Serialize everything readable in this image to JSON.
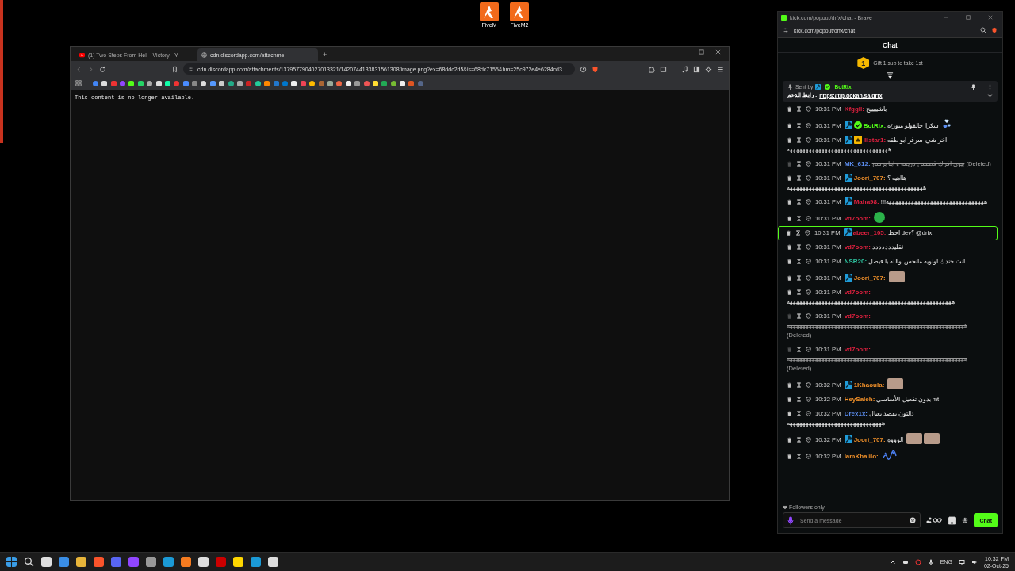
{
  "desktop": {
    "icons": [
      {
        "label": "FiveM"
      },
      {
        "label": "FiveM2"
      }
    ]
  },
  "browser": {
    "tabs": [
      {
        "title": "(1) Two Steps From Hell - Victory - Y",
        "selected": false,
        "kind": "video"
      },
      {
        "title": "cdn.discordapp.com/attachme",
        "selected": true,
        "kind": "web"
      }
    ],
    "new_tab": "+",
    "url": "cdn.discordapp.com/attachments/1379577904027013321/1420744133831561308/image.png?ex=68ddc2d5&is=68dc7155&hm=25c972e4e6284cd3...",
    "content": "This content is no longer available."
  },
  "chat_window": {
    "title": "kick.com/popout/drfx/chat - Brave",
    "url": "kick.com/popout/drfx/chat",
    "header": "Chat",
    "gift": {
      "rank": "1",
      "text": "Gift 1 sub to take 1st"
    },
    "pinned": {
      "sent_by": "Sent by",
      "author": "BotRix",
      "label": "رابط الدعم :",
      "link": "https://tip.dokan.sa/drfx"
    },
    "messages": [
      {
        "time": "10:31 PM",
        "username": "Kfggll:",
        "color": "#e0203f",
        "text": "باشيييييخ",
        "deleted": false,
        "highlighted": false
      },
      {
        "time": "10:31 PM",
        "username": "BotRix:",
        "color": "#53fc18",
        "badges": [
          {
            "kind": "moderator"
          },
          {
            "kind": "verified"
          }
        ],
        "text": "شكرا حالفولو متور/ه",
        "deleted": false,
        "highlighted": false,
        "emotes": [
          {
            "kind": "hearts"
          }
        ]
      },
      {
        "time": "10:31 PM",
        "username": "lllstar1:",
        "color": "#e0203f",
        "badges": [
          {
            "kind": "moderator"
          },
          {
            "kind": "crown"
          }
        ],
        "text": "اخر شي سرفر ابو طقه",
        "continued": "ههههههههههههههههههههههههههههههههه",
        "deleted": false,
        "highlighted": false
      },
      {
        "time": "10:31 PM",
        "username": "MK_612:",
        "color": "#5b8def",
        "text": "بيوي افرك قصسن دريمه و ابنا برسج",
        "note": "(Deleted)",
        "deleted": true,
        "highlighted": false
      },
      {
        "time": "10:31 PM",
        "username": "Joori_707:",
        "color": "#f0902a",
        "badges": [
          {
            "kind": "moderator"
          }
        ],
        "text": "هااهيه ؟",
        "continued": "هههههههههههههههههههههههههههههههههههههههههههه",
        "deleted": false,
        "highlighted": false
      },
      {
        "time": "10:31 PM",
        "username": "Maha98:",
        "color": "#e0203f",
        "badges": [
          {
            "kind": "moderator"
          }
        ],
        "text": "!!!هههههههههههههههههههههههههههههههه",
        "deleted": false,
        "highlighted": false
      },
      {
        "time": "10:31 PM",
        "username": "vd7oom:",
        "color": "#e0203f",
        "deleted": false,
        "highlighted": false,
        "emotes": [
          {
            "kind": "sticker"
          }
        ]
      },
      {
        "time": "10:31 PM",
        "username": "abeer_105:",
        "color": "#e0203f",
        "badges": [
          {
            "kind": "moderator"
          }
        ],
        "text": "احط dev؟ @drfx",
        "deleted": false,
        "highlighted": true
      },
      {
        "time": "10:31 PM",
        "username": "vd7oom:",
        "color": "#e0203f",
        "text": "ثقليددددددد",
        "deleted": false,
        "highlighted": false
      },
      {
        "time": "10:31 PM",
        "username": "NSR20:",
        "color": "#2ec4a0",
        "text": "انت حندك اولويه مانحس والله يا فيصل",
        "deleted": false,
        "highlighted": false
      },
      {
        "time": "10:31 PM",
        "username": "Joori_707:",
        "color": "#f0902a",
        "badges": [
          {
            "kind": "moderator"
          }
        ],
        "deleted": false,
        "highlighted": false,
        "emotes": [
          {
            "kind": "photo"
          }
        ]
      },
      {
        "time": "10:31 PM",
        "username": "vd7oom:",
        "color": "#e0203f",
        "text": "ههههههههههههههههههههههههههههههههههههههههههههههههههههه",
        "deleted": false,
        "highlighted": false
      },
      {
        "time": "10:31 PM",
        "username": "vd7oom:",
        "color": "#e0203f",
        "text": "ههههههههههههههههههههههههههههههههههههههههههههههههههههههههه",
        "note": "(Deleted)",
        "deleted": true,
        "highlighted": false
      },
      {
        "time": "10:31 PM",
        "username": "vd7oom:",
        "color": "#e0203f",
        "text": "ههههههههههههههههههههههههههههههههههههههههههههههههههههههههه",
        "note": "(Deleted)",
        "deleted": true,
        "highlighted": false
      },
      {
        "time": "10:32 PM",
        "username": "1Khaoula:",
        "color": "#f0902a",
        "badges": [
          {
            "kind": "moderator"
          }
        ],
        "deleted": false,
        "highlighted": false,
        "emotes": [
          {
            "kind": "photo"
          }
        ]
      },
      {
        "time": "10:32 PM",
        "username": "HeySaleh:",
        "color": "#f0902a",
        "text": "بدون تفعيل الأساسي mt",
        "deleted": false,
        "highlighted": false
      },
      {
        "time": "10:32 PM",
        "username": "Drex1x:",
        "color": "#5b8def",
        "text": "دالتون يقصد بعيال",
        "continued": "ههههههههههههههههههههههههههههههه",
        "deleted": false,
        "highlighted": false
      },
      {
        "time": "10:32 PM",
        "username": "Joori_707:",
        "color": "#f0902a",
        "badges": [
          {
            "kind": "moderator"
          }
        ],
        "text": "الوووه",
        "deleted": false,
        "highlighted": false,
        "emotes": [
          {
            "kind": "photo"
          },
          {
            "kind": "photo"
          }
        ]
      },
      {
        "time": "10:32 PM",
        "username": "IamKhalilo:",
        "color": "#f0902a",
        "deleted": false,
        "highlighted": false,
        "emotes": [
          {
            "kind": "script"
          }
        ]
      }
    ],
    "mode": "Followers only",
    "input": {
      "placeholder": "Send a message"
    },
    "send": "Chat"
  },
  "taskbar": {
    "language": "ENG",
    "time": "10:32 PM",
    "date": "02-Oct-25"
  }
}
